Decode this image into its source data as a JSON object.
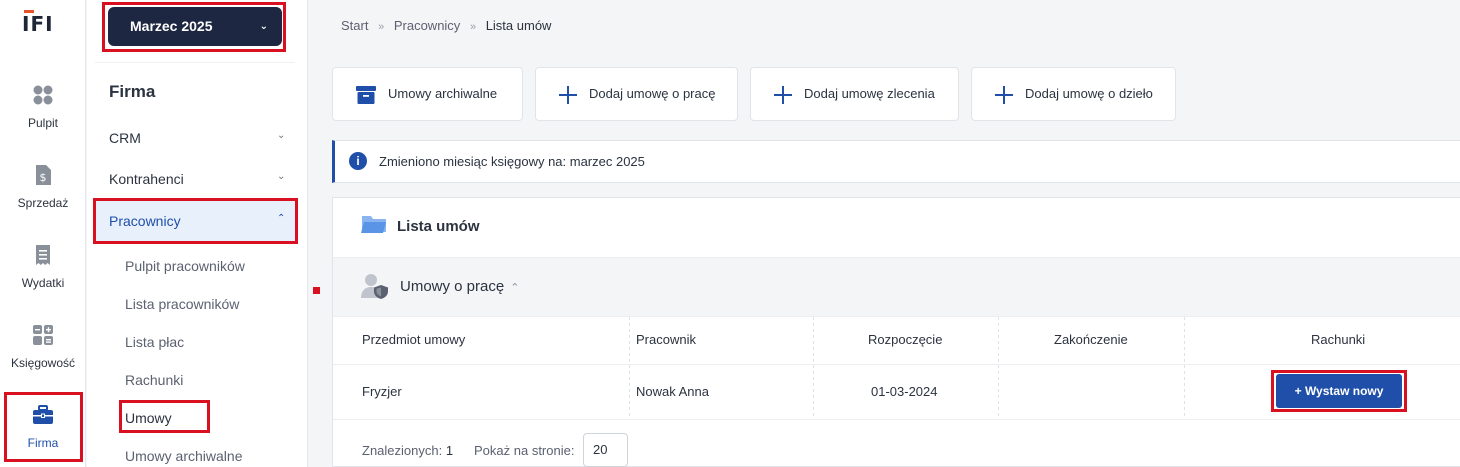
{
  "rail": {
    "logo": "IFI",
    "items": [
      {
        "label": "Pulpit",
        "icon": "dashboard-icon"
      },
      {
        "label": "Sprzedaż",
        "icon": "invoice-dollar-icon"
      },
      {
        "label": "Wydatki",
        "icon": "receipt-icon"
      },
      {
        "label": "Księgowość",
        "icon": "calculator-icon"
      },
      {
        "label": "Firma",
        "icon": "briefcase-icon"
      }
    ]
  },
  "submenu": {
    "month": "Marzec 2025",
    "heading": "Firma",
    "items": [
      {
        "label": "CRM"
      },
      {
        "label": "Kontrahenci"
      },
      {
        "label": "Pracownicy"
      }
    ],
    "children": [
      {
        "label": "Pulpit pracowników"
      },
      {
        "label": "Lista pracowników"
      },
      {
        "label": "Lista płac"
      },
      {
        "label": "Rachunki"
      },
      {
        "label": "Umowy"
      },
      {
        "label": "Umowy archiwalne"
      }
    ]
  },
  "breadcrumb": {
    "items": [
      "Start",
      "Pracownicy",
      "Lista umów"
    ]
  },
  "actions": [
    {
      "label": "Umowy archiwalne",
      "icon": "archive-box-icon"
    },
    {
      "label": "Dodaj umowę o pracę",
      "icon": "plus-icon"
    },
    {
      "label": "Dodaj umowę zlecenia",
      "icon": "plus-icon"
    },
    {
      "label": "Dodaj umowę o dzieło",
      "icon": "plus-icon"
    }
  ],
  "info": {
    "text": "Zmieniono miesiąc księgowy na: marzec 2025",
    "icon": "info-icon"
  },
  "panel": {
    "title": "Lista umów",
    "section": "Umowy o pracę",
    "columns": [
      "Przedmiot umowy",
      "Pracownik",
      "Rozpoczęcie",
      "Zakończenie",
      "Rachunki"
    ],
    "rows": [
      {
        "subject": "Fryzjer",
        "employee": "Nowak Anna",
        "start": "01-03-2024",
        "end": ""
      }
    ],
    "issue_button": "Wystaw nowy",
    "found_label": "Znalezionych:",
    "found_count": "1",
    "per_page_label": "Pokaż na stronie:",
    "per_page_value": "20"
  },
  "colors": {
    "accent": "#1f4fa8",
    "dark": "#1d2742",
    "highlight": "#d9101f"
  }
}
